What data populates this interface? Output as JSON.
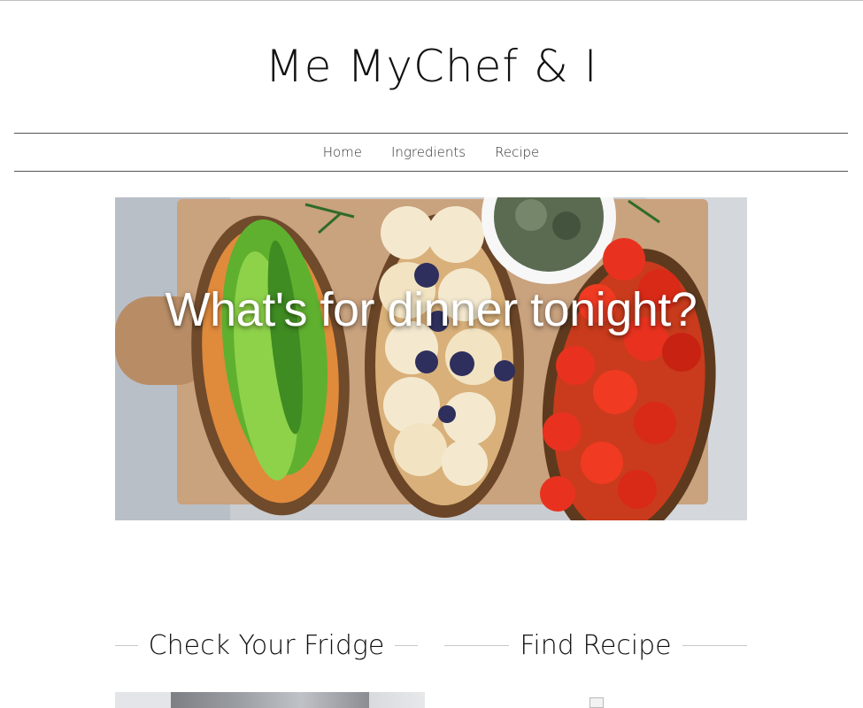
{
  "site": {
    "title": "Me MyChef & I"
  },
  "nav": {
    "items": [
      "Home",
      "Ingredients",
      "Recipe"
    ]
  },
  "hero": {
    "caption": "What's for dinner tonight?"
  },
  "sections": {
    "fridge_heading": "Check Your Fridge",
    "recipe_heading": "Find Recipe"
  },
  "colors": {
    "background": "#ffffff",
    "text": "#111111",
    "rule": "#555555"
  }
}
